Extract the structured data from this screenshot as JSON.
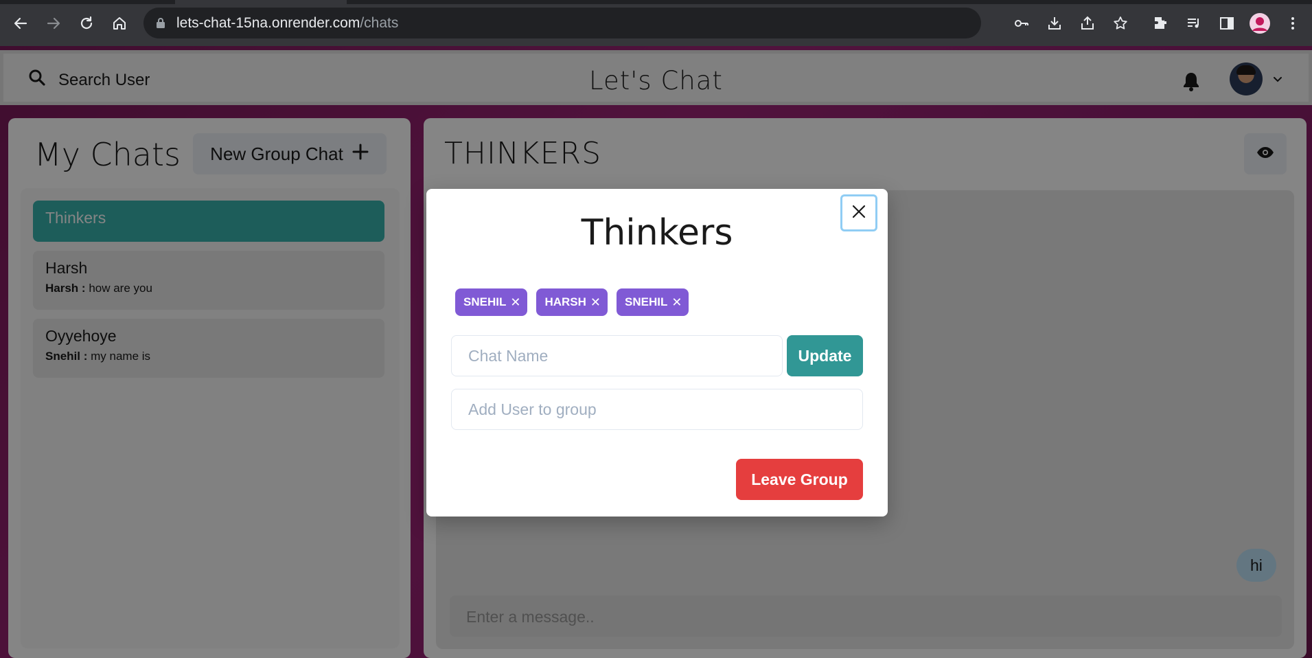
{
  "browser": {
    "url_host": "lets-chat-15na.onrender.com",
    "url_path": "/chats"
  },
  "header": {
    "search_label": "Search User",
    "app_title": "Let's Chat",
    "icons": [
      "search-icon",
      "bell-icon",
      "avatar",
      "chevron-down-icon"
    ]
  },
  "sidebar": {
    "title": "My Chats",
    "new_group_label": "New Group Chat",
    "chats": [
      {
        "name": "Thinkers",
        "active": true
      },
      {
        "name": "Harsh",
        "sender": "Harsh :",
        "message": "how are you"
      },
      {
        "name": "Oyyehoye",
        "sender": "Snehil :",
        "message": "my name is"
      }
    ]
  },
  "chat": {
    "title": "THINKERS",
    "messages": [
      {
        "text": "hi"
      }
    ],
    "input_placeholder": "Enter a message.."
  },
  "modal": {
    "title": "Thinkers",
    "members": [
      "SNEHIL",
      "HARSH",
      "SNEHIL"
    ],
    "chat_name_placeholder": "Chat Name",
    "update_label": "Update",
    "add_user_placeholder": "Add User to group",
    "leave_label": "Leave Group"
  },
  "colors": {
    "accent_teal": "#38b2ac",
    "update_teal": "#319795",
    "chip_purple": "#805ad5",
    "danger_red": "#e53e3e",
    "bubble_blue": "#bee3f8"
  }
}
